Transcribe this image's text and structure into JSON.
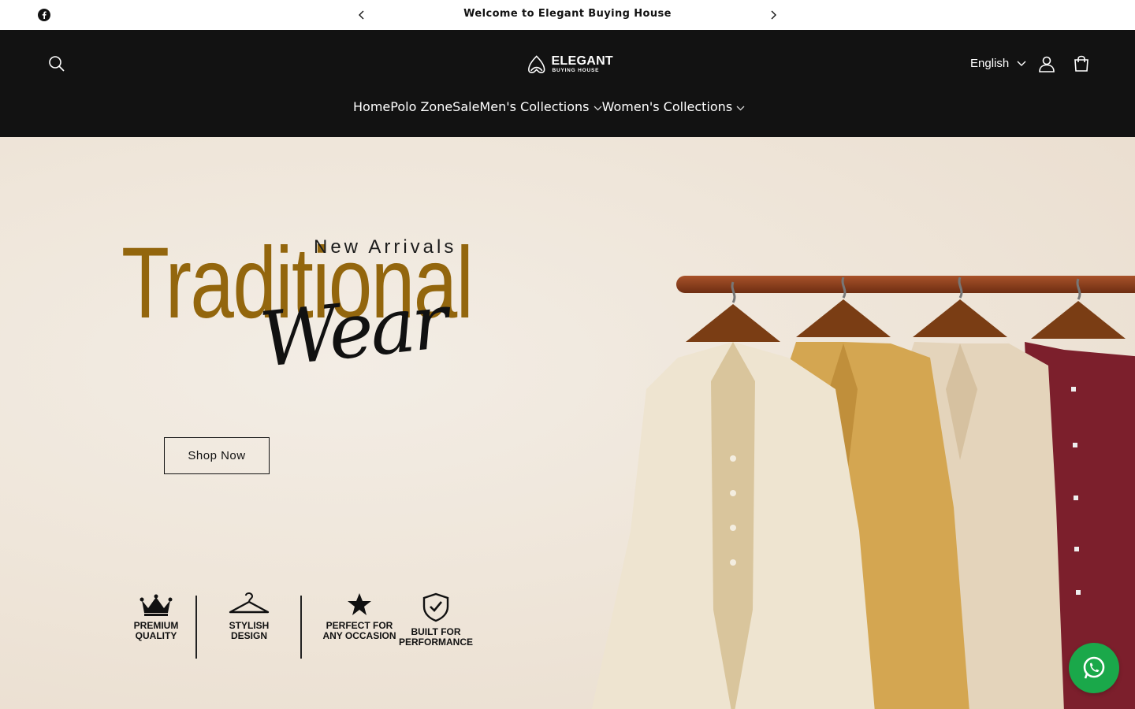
{
  "announcement": {
    "message": "Welcome to Elegant Buying House",
    "social": [
      "facebook-icon"
    ]
  },
  "header": {
    "logo": {
      "name": "ELEGANT",
      "tagline": "BUYING HOUSE"
    },
    "language": "English",
    "icons": [
      "search-icon",
      "account-icon",
      "cart-icon"
    ]
  },
  "nav": {
    "items": [
      {
        "label": "Home",
        "active": true
      },
      {
        "label": "Polo Zone"
      },
      {
        "label": "Sale"
      },
      {
        "label": "Men's Collections",
        "dropdown": true
      },
      {
        "label": "Women's Collections",
        "dropdown": true
      }
    ]
  },
  "hero": {
    "subtitle": "New Arrivals",
    "title": "Traditional",
    "script": "Wear",
    "cta": "Shop Now",
    "title_color": "#93660d",
    "features": [
      {
        "label": "PREMIUM\nQUALITY",
        "icon": "crown-icon"
      },
      {
        "label": "STYLISH\nDESIGN",
        "icon": "hanger-icon"
      },
      {
        "label": "PERFECT FOR\nANY OCCASION",
        "icon": "star-icon"
      },
      {
        "label": "BUILT FOR\nPERFORMANCE",
        "icon": "shield-check-icon"
      }
    ]
  },
  "whatsapp": {
    "icon": "whatsapp-icon",
    "color": "#1aa84a"
  }
}
